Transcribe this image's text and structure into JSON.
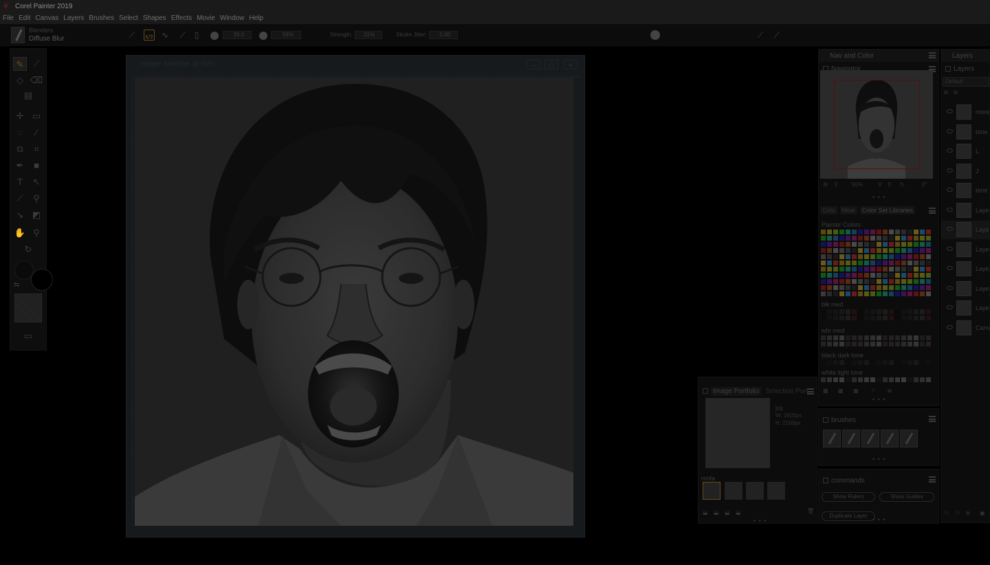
{
  "app": {
    "title": "Corel Painter 2019"
  },
  "menu": [
    "File",
    "Edit",
    "Canvas",
    "Layers",
    "Brushes",
    "Select",
    "Shapes",
    "Effects",
    "Movie",
    "Window",
    "Help"
  ],
  "property_bar": {
    "brush_category": "Blenders",
    "brush_variant": "Diffuse Blur",
    "size_value": "39.0",
    "opacity_value": "56%",
    "strength_label": "Strength:",
    "strength_value": "21%",
    "stroke_jitter_label": "Stroke Jitter:",
    "stroke_jitter_value": "0.00"
  },
  "document": {
    "title": "Harper Smeltzer @ 50%",
    "controls": {
      "minimize": "—",
      "maximize": "☐",
      "close": "✕"
    }
  },
  "nav_color_panel": {
    "title": "Nav and Color",
    "navigator_label": "Navigator",
    "zoom_value": "50%",
    "rotation_value": "0°",
    "tabs": [
      "Colo",
      "Mixe",
      "Color Set Libraries"
    ],
    "sets": [
      {
        "name": "Painter Colors"
      },
      {
        "name": "blk med"
      },
      {
        "name": "whi med"
      },
      {
        "name": "black dark tone"
      },
      {
        "name": "white light tone"
      }
    ]
  },
  "portfolio_panel": {
    "tabs": [
      "Image Portfolio",
      "Selection Port"
    ],
    "info": {
      "format": "jpg",
      "width": "W: 1920px",
      "height": "H: 2160px"
    },
    "library_label": "rimfa"
  },
  "brushes_panel": {
    "title": "brushes"
  },
  "commands_panel": {
    "title": "commands",
    "buttons": [
      "Show Rulers",
      "Show Guides",
      "Duplicate Layer"
    ]
  },
  "layers_panel": {
    "title": "Layers",
    "sub_title": "Layers",
    "composite_method": "Default",
    "layers": [
      {
        "name": "more"
      },
      {
        "name": "tone"
      },
      {
        "name": "L"
      },
      {
        "name": "J"
      },
      {
        "name": "tone"
      },
      {
        "name": "Laye"
      },
      {
        "name": "Laye"
      },
      {
        "name": "Laye"
      },
      {
        "name": "Laye"
      },
      {
        "name": "Laye"
      },
      {
        "name": "Laye"
      },
      {
        "name": "Canv"
      }
    ]
  },
  "colors": {
    "accent": "#6b4a1c",
    "navigator_frame": "#5a0c0c",
    "background": "#000000",
    "panel_bg": "#0c0c0c"
  }
}
